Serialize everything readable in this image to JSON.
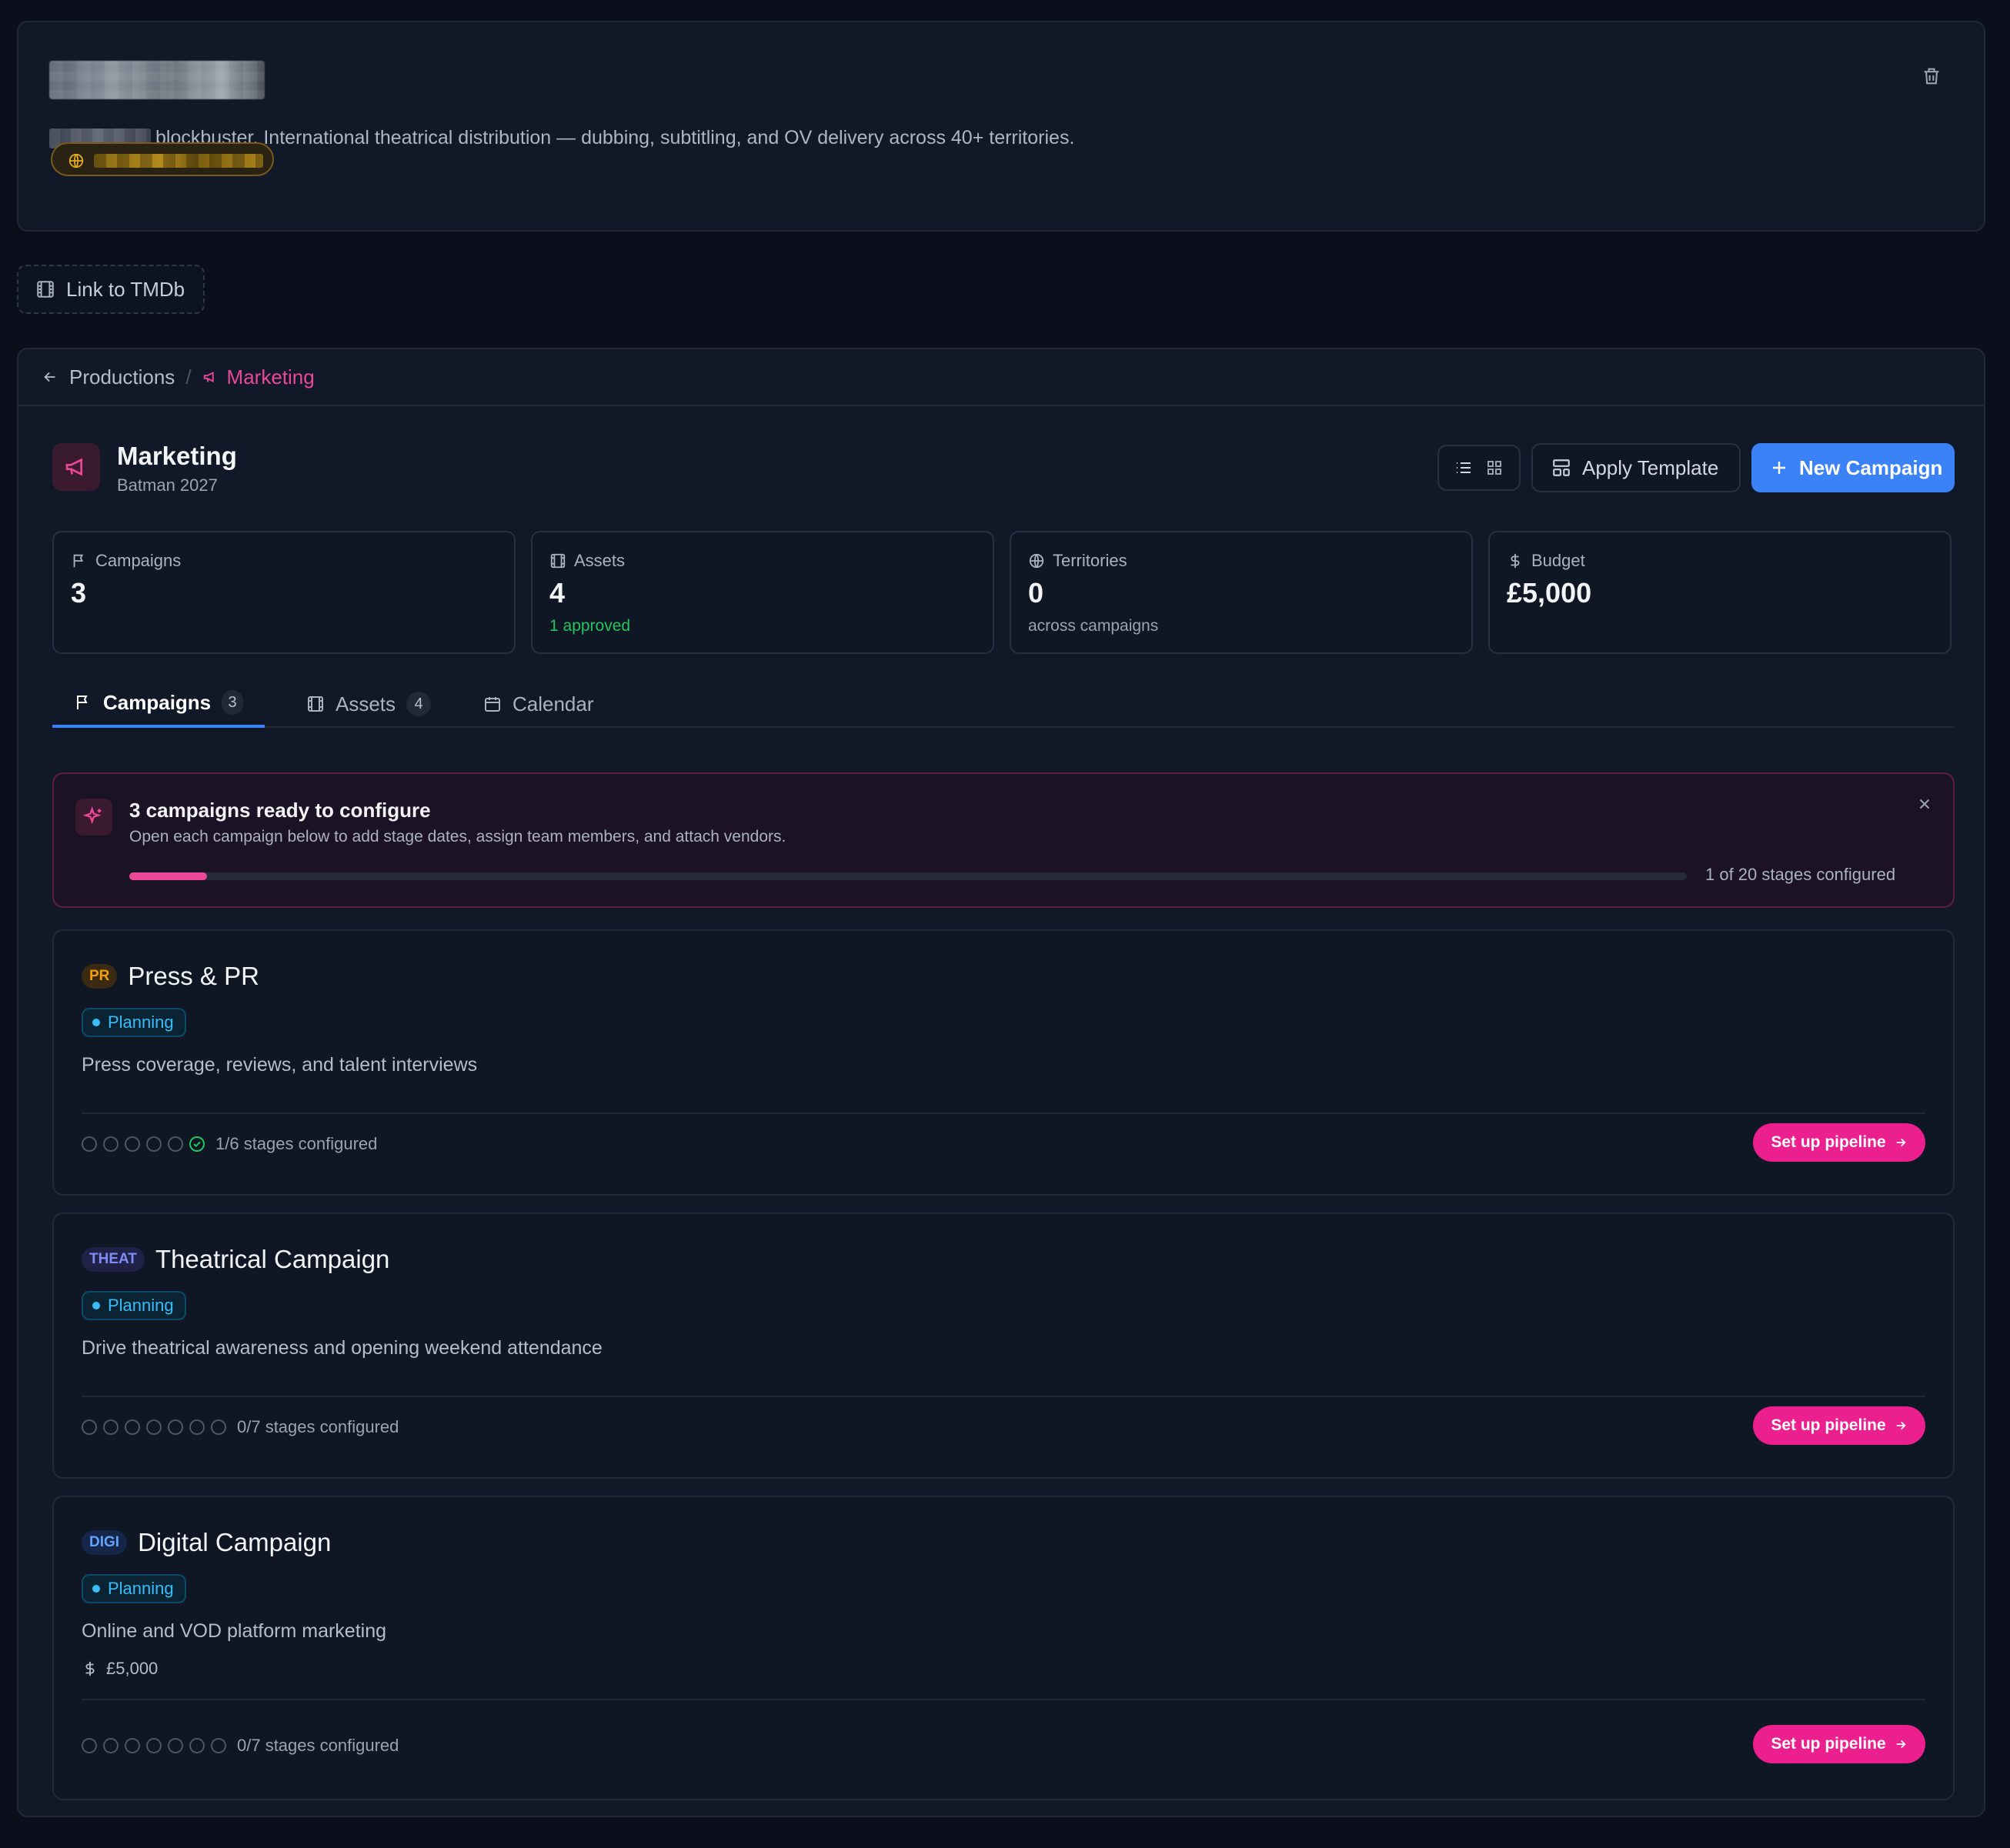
{
  "hero": {
    "description": "blockbuster. International theatrical distribution — dubbing, subtitling, and OV delivery across 40+ territories."
  },
  "tmdb": {
    "label": "Link to TMDb"
  },
  "breadcrumb": {
    "parent": "Productions",
    "separator": "/",
    "current": "Marketing"
  },
  "page": {
    "title": "Marketing",
    "subtitle": "Batman 2027"
  },
  "toolbar": {
    "apply_template": "Apply Template",
    "new_campaign": "New Campaign"
  },
  "stats": [
    {
      "label": "Campaigns",
      "value": "3",
      "note": ""
    },
    {
      "label": "Assets",
      "value": "4",
      "note": "1 approved"
    },
    {
      "label": "Territories",
      "value": "0",
      "note": "across campaigns"
    },
    {
      "label": "Budget",
      "value": "£5,000",
      "note": ""
    }
  ],
  "tabs": [
    {
      "label": "Campaigns",
      "count": "3"
    },
    {
      "label": "Assets",
      "count": "4"
    },
    {
      "label": "Calendar"
    }
  ],
  "banner": {
    "title": "3 campaigns ready to configure",
    "subtitle": "Open each campaign below to add stage dates, assign team members, and attach vendors.",
    "progress_text": "1 of 20 stages configured",
    "progress": 0.05
  },
  "campaigns": [
    {
      "code": "PR",
      "name": "Press & PR",
      "status": "Planning",
      "description": "Press coverage, reviews, and talent interviews",
      "stages_text": "1/6 stages configured",
      "stages_total": 6,
      "stages_done": 1,
      "action": "Set up pipeline",
      "code_color": "#f59e0b",
      "code_bg": "#3a2a12"
    },
    {
      "code": "THEAT",
      "name": "Theatrical Campaign",
      "status": "Planning",
      "description": "Drive theatrical awareness and opening weekend attendance",
      "stages_text": "0/7 stages configured",
      "stages_total": 7,
      "stages_done": 0,
      "action": "Set up pipeline",
      "code_color": "#818cf8",
      "code_bg": "#1f2146"
    },
    {
      "code": "DIGI",
      "name": "Digital Campaign",
      "status": "Planning",
      "description": "Online and VOD platform marketing",
      "budget": "£5,000",
      "stages_text": "0/7 stages configured",
      "stages_total": 7,
      "stages_done": 0,
      "action": "Set up pipeline",
      "code_color": "#60a5fa",
      "code_bg": "#16264a"
    }
  ],
  "colors": {
    "accent": "#3b82f6",
    "pink": "#ec4899",
    "success": "#22c55e",
    "status": "#38bdf8"
  }
}
